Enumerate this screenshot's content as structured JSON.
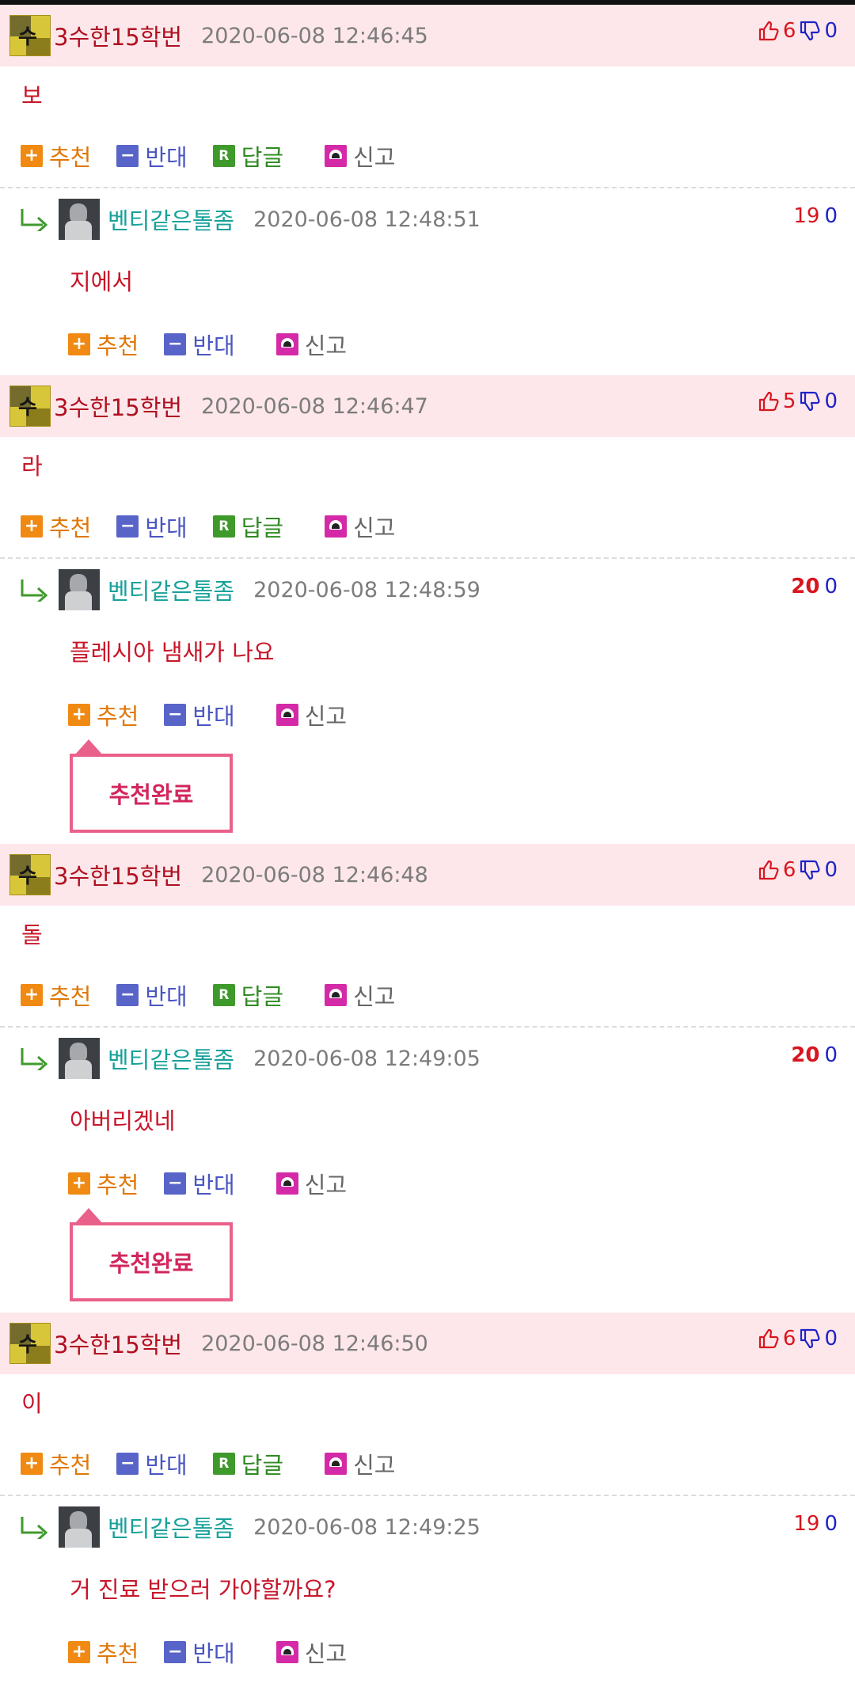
{
  "labels": {
    "recommend": "추천",
    "oppose": "반대",
    "reply": "답글",
    "report": "신고",
    "reply_icon": "R",
    "plus_icon": "+",
    "minus_icon": "−"
  },
  "popup_text": "추천완료",
  "icons": {
    "thumb_up": "thumb-up-icon",
    "thumb_down": "thumb-down-icon",
    "reply_arrow": "reply-arrow-icon"
  },
  "threads": [
    {
      "parent": {
        "nick": "3수한15학번",
        "date": "2020-06-08 12:46:45",
        "up": "6",
        "down": "0",
        "text": "보"
      },
      "reply": {
        "nick": "벤티같은톨좀",
        "date": "2020-06-08 12:48:51",
        "up": "19",
        "down": "0",
        "text": "지에서",
        "up_bold": false,
        "popup": false
      }
    },
    {
      "parent": {
        "nick": "3수한15학번",
        "date": "2020-06-08 12:46:47",
        "up": "5",
        "down": "0",
        "text": "라"
      },
      "reply": {
        "nick": "벤티같은톨좀",
        "date": "2020-06-08 12:48:59",
        "up": "20",
        "down": "0",
        "text": "플레시아 냄새가 나요",
        "up_bold": true,
        "popup": true
      }
    },
    {
      "parent": {
        "nick": "3수한15학번",
        "date": "2020-06-08 12:46:48",
        "up": "6",
        "down": "0",
        "text": "돌"
      },
      "reply": {
        "nick": "벤티같은톨좀",
        "date": "2020-06-08 12:49:05",
        "up": "20",
        "down": "0",
        "text": "아버리겠네",
        "up_bold": true,
        "popup": true
      }
    },
    {
      "parent": {
        "nick": "3수한15학번",
        "date": "2020-06-08 12:46:50",
        "up": "6",
        "down": "0",
        "text": "이"
      },
      "reply": {
        "nick": "벤티같은톨좀",
        "date": "2020-06-08 12:49:25",
        "up": "19",
        "down": "0",
        "text": "거 진료 받으러 가야할까요?",
        "up_bold": false,
        "popup": false
      }
    }
  ]
}
